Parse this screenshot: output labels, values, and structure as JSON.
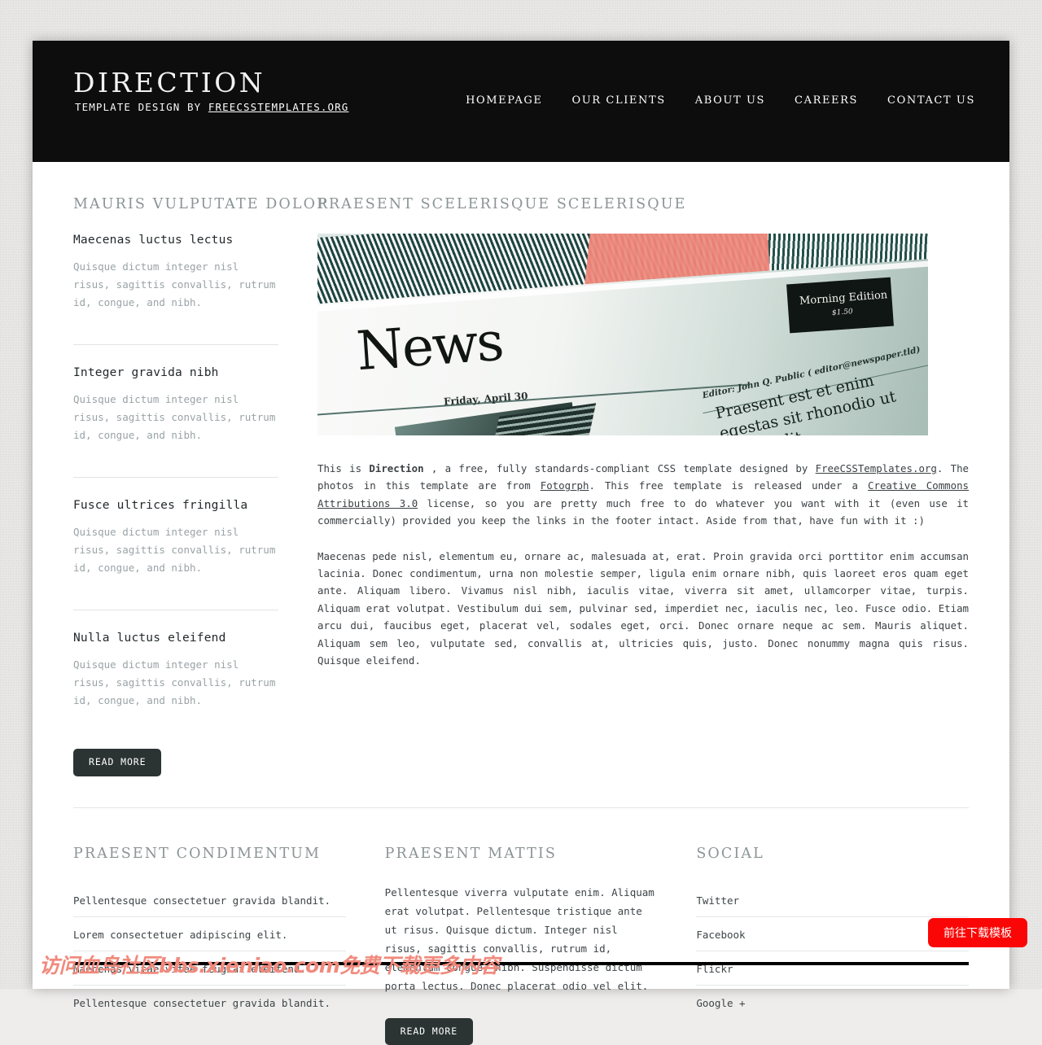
{
  "site": {
    "logo": "DIRECTION",
    "tagline_prefix": "TEMPLATE DESIGN BY",
    "tagline_link": "FREECSSTEMPLATES.ORG"
  },
  "nav": {
    "items": [
      {
        "label": "HOMEPAGE"
      },
      {
        "label": "OUR CLIENTS"
      },
      {
        "label": "ABOUT US"
      },
      {
        "label": "CAREERS"
      },
      {
        "label": "CONTACT US"
      }
    ]
  },
  "sidebar": {
    "heading": "MAURIS VULPUTATE DOLOR",
    "items": [
      {
        "title": "Maecenas luctus lectus",
        "text": "Quisque dictum integer nisl risus, sagittis convallis, rutrum id, congue, and nibh."
      },
      {
        "title": "Integer gravida nibh",
        "text": "Quisque dictum integer nisl risus, sagittis convallis, rutrum id, congue, and nibh."
      },
      {
        "title": "Fusce ultrices fringilla",
        "text": "Quisque dictum integer nisl risus, sagittis convallis, rutrum id, congue, and nibh."
      },
      {
        "title": "Nulla luctus eleifend",
        "text": "Quisque dictum integer nisl risus, sagittis convallis, rutrum id, congue, and nibh."
      }
    ],
    "read_more": "READ MORE"
  },
  "main": {
    "heading": "PRAESENT SCELERISQUE SCELERISQUE",
    "figure": {
      "masthead": "News",
      "date": "Friday, April 30",
      "edition_label": "Morning Edition",
      "edition_price": "$1.50",
      "editor_line": "Editor: John Q. Public ( editor@newspaper.tld)",
      "subhead_line1": "Praesent est et enim",
      "subhead_line2": "egestas sit rhonodio ut",
      "subhead_line3": "sit blandit"
    },
    "paragraph_1": {
      "t1": "This is ",
      "bold": "Direction",
      "t2": " , a free, fully standards-compliant CSS template designed by ",
      "link1": "FreeCSSTemplates.org",
      "t3": ". The photos in this template are from ",
      "link2": "Fotogrph",
      "t4": ". This free template is released under a ",
      "link3": "Creative Commons Attributions 3.0",
      "t5": " license, so you are pretty much free to do whatever you want with it (even use it commercially) provided you keep the links in the footer intact. Aside from that, have fun with it :)"
    },
    "paragraph_2": "Maecenas pede nisl, elementum eu, ornare ac, malesuada at, erat. Proin gravida orci porttitor enim accumsan lacinia. Donec condimentum, urna non molestie semper, ligula enim ornare nibh, quis laoreet eros quam eget ante. Aliquam libero. Vivamus nisl nibh, iaculis vitae, viverra sit amet, ullamcorper vitae, turpis. Aliquam erat volutpat. Vestibulum dui sem, pulvinar sed, imperdiet nec, iaculis nec, leo. Fusce odio. Etiam arcu dui, faucibus eget, placerat vel, sodales eget, orci. Donec ornare neque ac sem. Mauris aliquet. Aliquam sem leo, vulputate sed, convallis at, ultricies quis, justo. Donec nonummy magna quis risus. Quisque eleifend."
  },
  "footer": {
    "col1": {
      "heading": "PRAESENT CONDIMENTUM",
      "items": [
        "Pellentesque consectetuer gravida blandit.",
        "Lorem consectetuer adipiscing elit.",
        "Maecenas vitae vitae feugiat eleifend.",
        "Pellentesque consectetuer gravida blandit."
      ]
    },
    "col2": {
      "heading": "PRAESENT MATTIS",
      "text": "Pellentesque viverra vulputate enim. Aliquam erat volutpat. Pellentesque tristique ante ut risus. Quisque dictum. Integer nisl risus, sagittis convallis, rutrum id, elementum congue, nibh. Suspendisse dictum porta lectus. Donec placerat odio vel elit.",
      "read_more": "READ MORE"
    },
    "col3": {
      "heading": "SOCIAL",
      "items": [
        "Twitter",
        "Facebook",
        "Flickr",
        "Google +"
      ]
    }
  },
  "overlay": {
    "watermark": "访问血鸟社区bbs.xieniao.com免费下载更多内容",
    "download_button": "前往下载模板"
  },
  "colors": {
    "header_bg": "#0d0d0d",
    "button_dark": "#2b3432",
    "accent_red": "#fb0606",
    "watermark_red": "#f08a7d",
    "heading_gray": "#8c9496",
    "body_text": "#3b4144"
  }
}
